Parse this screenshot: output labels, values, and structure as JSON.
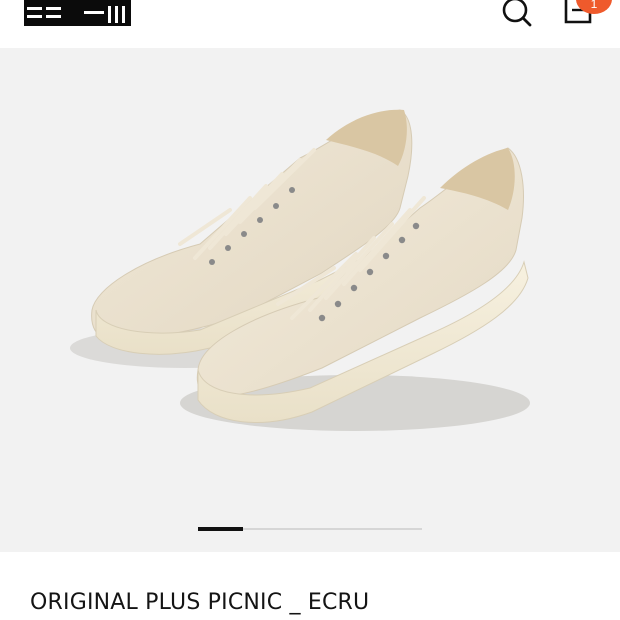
{
  "header": {
    "logo": "brand-logo",
    "icons": {
      "search": "search-icon",
      "cart": "bag-icon"
    },
    "cart_count": "1",
    "badge_color": "#ef5a2c"
  },
  "gallery": {
    "image": "product-photo-sneakers",
    "background": "#f2f2f2",
    "pager": {
      "total": 5,
      "current": 1
    }
  },
  "product": {
    "name": "ORIGINAL PLUS PICNIC _ ECRU"
  }
}
